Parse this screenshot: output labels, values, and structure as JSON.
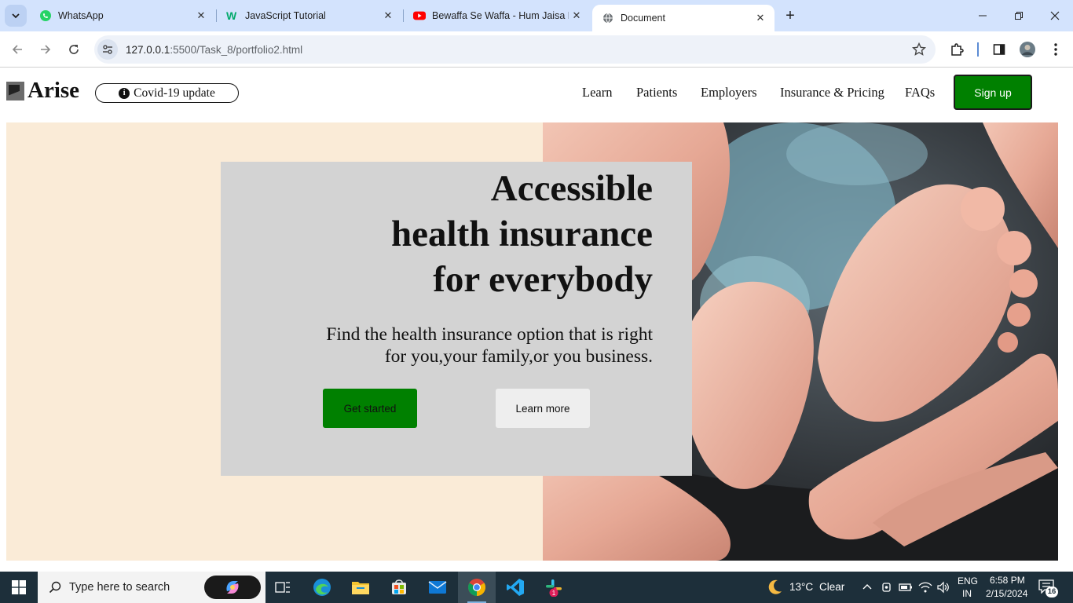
{
  "browser": {
    "tabs": [
      {
        "title": "WhatsApp",
        "icon": "whatsapp-icon",
        "active": false
      },
      {
        "title": "JavaScript Tutorial",
        "icon": "w3schools-icon",
        "active": false
      },
      {
        "title": "Bewaffa Se Waffa - Hum Jaisa K",
        "icon": "youtube-icon",
        "active": false
      },
      {
        "title": "Document",
        "icon": "globe-icon",
        "active": true
      }
    ],
    "url_host": "127.0.0.1",
    "url_path": ":5500/Task_8/portfolio2.html"
  },
  "site": {
    "logo_text": "Arise",
    "covid_label": "Covid-19 update",
    "nav": [
      "Learn",
      "Patients",
      "Employers",
      "Insurance & Pricing",
      "FAQs"
    ],
    "signup_label": "Sign up"
  },
  "hero": {
    "title_lines": [
      "Accessible",
      "health insurance",
      "for everybody"
    ],
    "subtitle_lines": [
      "Find the health insurance option that is right",
      "for you,your family,or you business."
    ],
    "primary_cta": "Get started",
    "secondary_cta": "Learn more"
  },
  "taskbar": {
    "search_placeholder": "Type here to search",
    "weather_temp": "13°C",
    "weather_text": "Clear",
    "lang_top": "ENG",
    "lang_bottom": "IN",
    "time": "6:58 PM",
    "date": "2/15/2024",
    "notification_count": "16",
    "slack_badge": "1"
  },
  "colors": {
    "brand_green": "#008000",
    "hero_left_bg": "#faebd7",
    "card_bg": "#d3d3d3",
    "tabstrip_bg": "#d3e3fd",
    "taskbar_bg": "#1d2f3a"
  }
}
